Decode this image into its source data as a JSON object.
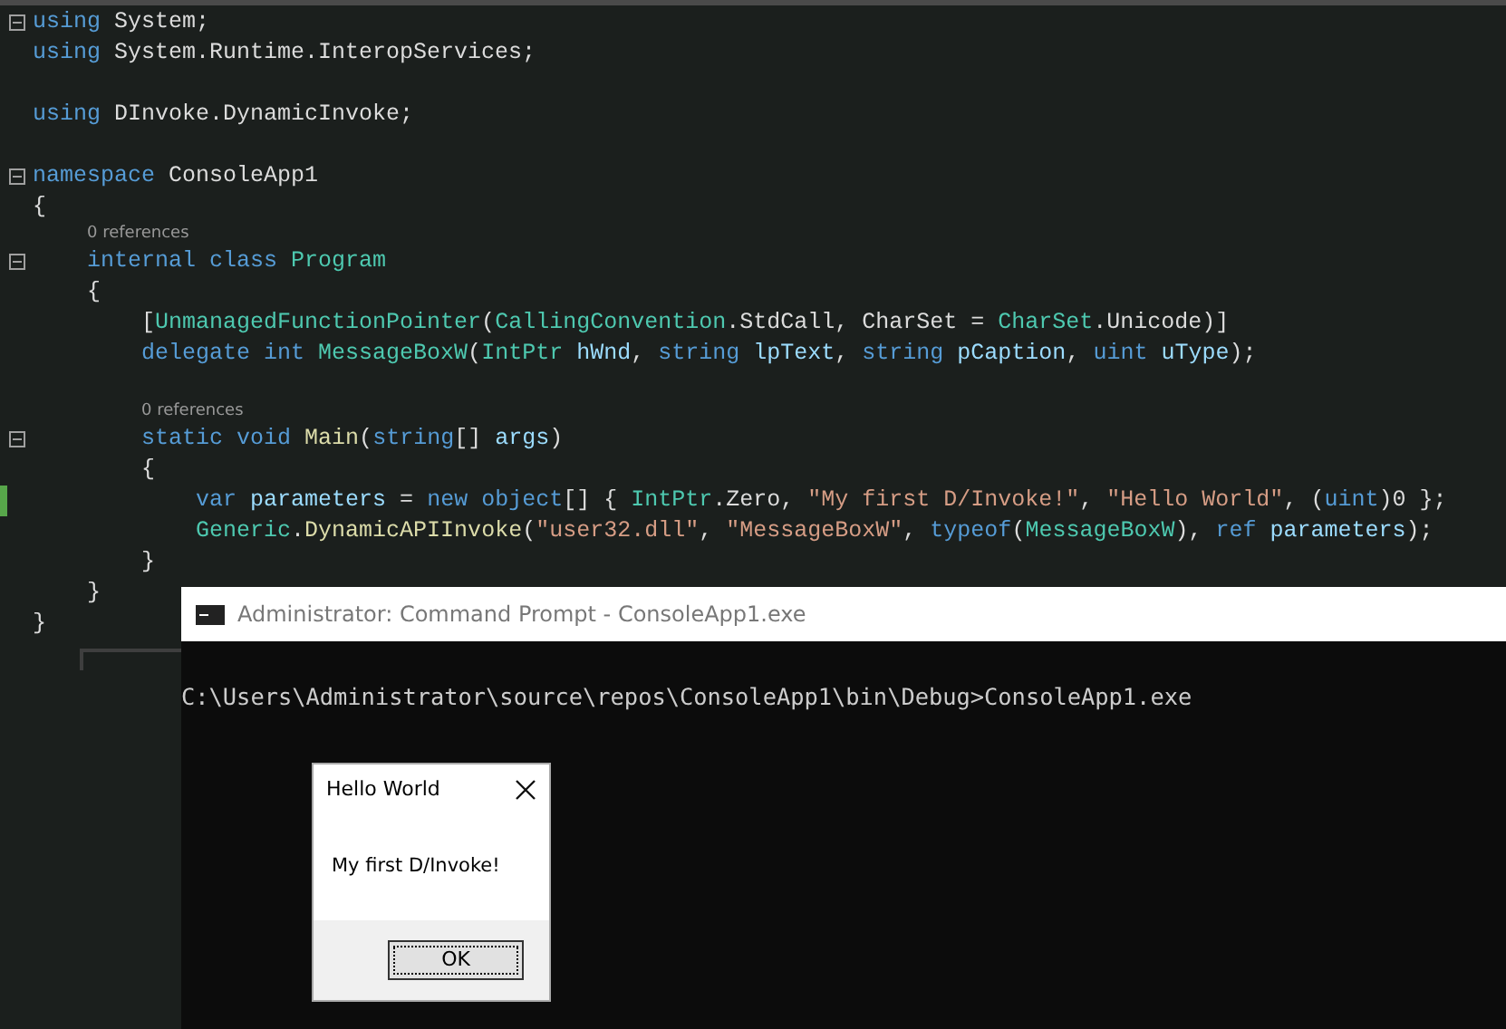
{
  "editor": {
    "lines": [
      {
        "kind": "code",
        "fold": true,
        "changed": false,
        "tokens": [
          {
            "text": "using",
            "kind": "kw"
          },
          {
            "text": " System;",
            "kind": "plain"
          }
        ]
      },
      {
        "kind": "code",
        "fold": false,
        "changed": false,
        "tokens": [
          {
            "text": "using",
            "kind": "kw"
          },
          {
            "text": " System.Runtime.InteropServices;",
            "kind": "plain"
          }
        ]
      },
      {
        "kind": "blank",
        "fold": false,
        "changed": false
      },
      {
        "kind": "code",
        "fold": false,
        "changed": false,
        "tokens": [
          {
            "text": "using",
            "kind": "kw"
          },
          {
            "text": " DInvoke.DynamicInvoke;",
            "kind": "plain"
          }
        ]
      },
      {
        "kind": "blank",
        "fold": false,
        "changed": false
      },
      {
        "kind": "code",
        "fold": true,
        "changed": false,
        "tokens": [
          {
            "text": "namespace",
            "kind": "kw"
          },
          {
            "text": " ConsoleApp1",
            "kind": "plain"
          }
        ]
      },
      {
        "kind": "code",
        "fold": false,
        "changed": false,
        "tokens": [
          {
            "text": "{",
            "kind": "plain"
          }
        ]
      },
      {
        "kind": "codelens",
        "text": "    0 references"
      },
      {
        "kind": "code",
        "fold": true,
        "changed": false,
        "tokens": [
          {
            "text": "    internal class",
            "kind": "kw"
          },
          {
            "text": " Program",
            "kind": "type"
          }
        ]
      },
      {
        "kind": "code",
        "fold": false,
        "changed": false,
        "tokens": [
          {
            "text": "    {",
            "kind": "plain"
          }
        ]
      },
      {
        "kind": "code",
        "fold": false,
        "changed": false,
        "tokens": [
          {
            "text": "        [",
            "kind": "plain"
          },
          {
            "text": "UnmanagedFunctionPointer",
            "kind": "type"
          },
          {
            "text": "(",
            "kind": "plain"
          },
          {
            "text": "CallingConvention",
            "kind": "type"
          },
          {
            "text": ".StdCall, CharSet = ",
            "kind": "plain"
          },
          {
            "text": "CharSet",
            "kind": "type"
          },
          {
            "text": ".Unicode)]",
            "kind": "plain"
          }
        ]
      },
      {
        "kind": "code",
        "fold": false,
        "changed": false,
        "tokens": [
          {
            "text": "        delegate int",
            "kind": "kw"
          },
          {
            "text": " MessageBoxW",
            "kind": "type"
          },
          {
            "text": "(",
            "kind": "plain"
          },
          {
            "text": "IntPtr",
            "kind": "type"
          },
          {
            "text": " hWnd",
            "kind": "id"
          },
          {
            "text": ", ",
            "kind": "plain"
          },
          {
            "text": "string",
            "kind": "kw"
          },
          {
            "text": " lpText",
            "kind": "id"
          },
          {
            "text": ", ",
            "kind": "plain"
          },
          {
            "text": "string",
            "kind": "kw"
          },
          {
            "text": " pCaption",
            "kind": "id"
          },
          {
            "text": ", ",
            "kind": "plain"
          },
          {
            "text": "uint",
            "kind": "kw"
          },
          {
            "text": " uType",
            "kind": "id"
          },
          {
            "text": ");",
            "kind": "plain"
          }
        ]
      },
      {
        "kind": "blank",
        "fold": false,
        "changed": false
      },
      {
        "kind": "codelens",
        "text": "        0 references"
      },
      {
        "kind": "code",
        "fold": true,
        "changed": false,
        "tokens": [
          {
            "text": "        static void",
            "kind": "kw"
          },
          {
            "text": " Main",
            "kind": "method"
          },
          {
            "text": "(",
            "kind": "plain"
          },
          {
            "text": "string",
            "kind": "kw"
          },
          {
            "text": "[] ",
            "kind": "plain"
          },
          {
            "text": "args",
            "kind": "id"
          },
          {
            "text": ")",
            "kind": "plain"
          }
        ]
      },
      {
        "kind": "code",
        "fold": false,
        "changed": false,
        "tokens": [
          {
            "text": "        {",
            "kind": "plain"
          }
        ]
      },
      {
        "kind": "code",
        "fold": false,
        "changed": true,
        "tokens": [
          {
            "text": "            var",
            "kind": "kw"
          },
          {
            "text": " parameters",
            "kind": "id"
          },
          {
            "text": " = ",
            "kind": "plain"
          },
          {
            "text": "new object",
            "kind": "kw"
          },
          {
            "text": "[] { ",
            "kind": "plain"
          },
          {
            "text": "IntPtr",
            "kind": "type"
          },
          {
            "text": ".Zero, ",
            "kind": "plain"
          },
          {
            "text": "\"My first D/Invoke!\"",
            "kind": "str"
          },
          {
            "text": ", ",
            "kind": "plain"
          },
          {
            "text": "\"Hello World\"",
            "kind": "str"
          },
          {
            "text": ", (",
            "kind": "plain"
          },
          {
            "text": "uint",
            "kind": "kw"
          },
          {
            "text": ")0 };",
            "kind": "plain"
          }
        ]
      },
      {
        "kind": "code",
        "fold": false,
        "changed": false,
        "tokens": [
          {
            "text": "            Generic",
            "kind": "type"
          },
          {
            "text": ".",
            "kind": "plain"
          },
          {
            "text": "DynamicAPIInvoke",
            "kind": "method"
          },
          {
            "text": "(",
            "kind": "plain"
          },
          {
            "text": "\"user32.dll\"",
            "kind": "str"
          },
          {
            "text": ", ",
            "kind": "plain"
          },
          {
            "text": "\"MessageBoxW\"",
            "kind": "str"
          },
          {
            "text": ", ",
            "kind": "plain"
          },
          {
            "text": "typeof",
            "kind": "kw"
          },
          {
            "text": "(",
            "kind": "plain"
          },
          {
            "text": "MessageBoxW",
            "kind": "type"
          },
          {
            "text": "), ",
            "kind": "plain"
          },
          {
            "text": "ref",
            "kind": "kw"
          },
          {
            "text": " parameters",
            "kind": "id"
          },
          {
            "text": ");",
            "kind": "plain"
          }
        ]
      },
      {
        "kind": "code",
        "fold": false,
        "changed": false,
        "tokens": [
          {
            "text": "        }",
            "kind": "plain"
          }
        ]
      },
      {
        "kind": "code",
        "fold": false,
        "changed": false,
        "tokens": [
          {
            "text": "    }",
            "kind": "plain"
          }
        ]
      },
      {
        "kind": "code",
        "fold": false,
        "changed": false,
        "tokens": [
          {
            "text": "}",
            "kind": "plain"
          }
        ]
      }
    ]
  },
  "console": {
    "title": "Administrator: Command Prompt - ConsoleApp1.exe",
    "output": "C:\\Users\\Administrator\\source\\repos\\ConsoleApp1\\bin\\Debug>ConsoleApp1.exe"
  },
  "message_box": {
    "title": "Hello World",
    "message": "My first D/Invoke!",
    "button": "OK"
  }
}
